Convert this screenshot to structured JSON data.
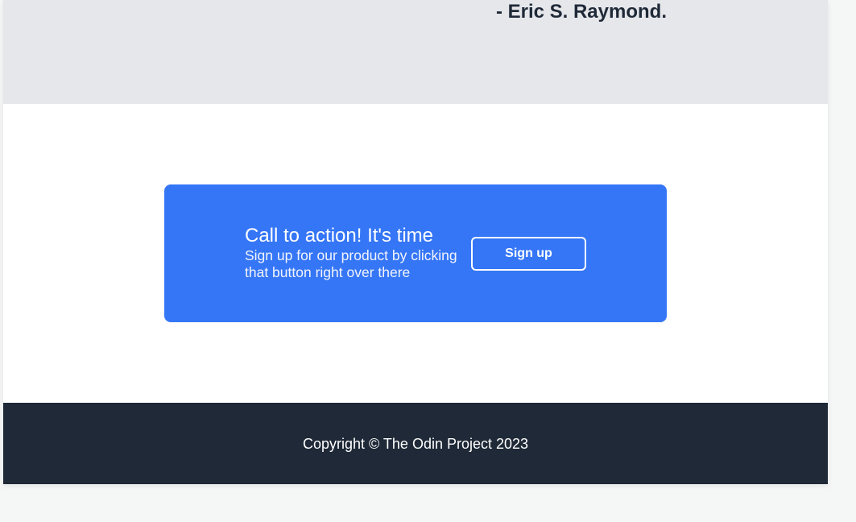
{
  "quote": {
    "author": "- Eric S. Raymond."
  },
  "cta": {
    "title": "Call to action! It's time",
    "subtitle": "Sign up for our product by clicking that button right over there",
    "button_label": "Sign up"
  },
  "footer": {
    "copyright": "Copyright © The Odin Project 2023"
  },
  "colors": {
    "quote_bg": "#e5e7eb",
    "cta_bg": "#3576f6",
    "footer_bg": "#1f2937",
    "text_dark": "#1f2937"
  }
}
